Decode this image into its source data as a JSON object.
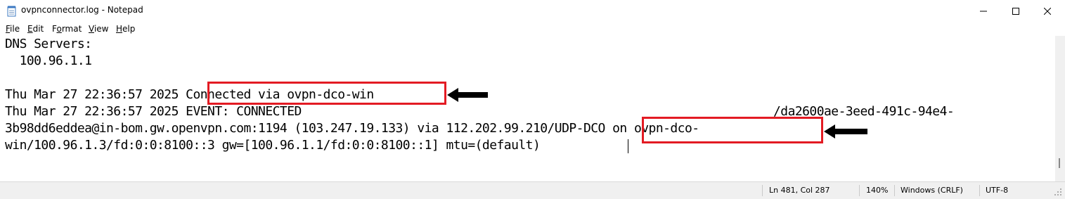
{
  "window": {
    "title": "ovpnconnector.log - Notepad",
    "icon": "notepad-icon"
  },
  "menu": {
    "items": [
      {
        "label_prefix": "",
        "accel": "F",
        "label_rest": "ile"
      },
      {
        "label_prefix": "",
        "accel": "E",
        "label_rest": "dit"
      },
      {
        "label_prefix": "F",
        "accel": "o",
        "label_rest": "rmat"
      },
      {
        "label_prefix": "",
        "accel": "V",
        "label_rest": "iew"
      },
      {
        "label_prefix": "",
        "accel": "H",
        "label_rest": "elp"
      }
    ]
  },
  "editor": {
    "lines": [
      "DNS Servers:",
      "  100.96.1.1",
      "",
      "Thu Mar 27 22:36:57 2025 Connected via ovpn-dco-win",
      "Thu Mar 27 22:36:57 2025 EVENT: CONNECTED ",
      "3b98dd6eddea@in-bom.gw.openvpn.com:1194 (103.247.19.133) via 112.202.99.210/UDP-DCO on ovpn-dco-",
      "win/100.96.1.3/fd:0:0:8100::3 gw=[100.96.1.1/fd:0:0:8100::1] mtu=(default)"
    ],
    "line4_tail": "/da2600ae-3eed-491c-94e4-"
  },
  "status": {
    "position": "Ln 481, Col 287",
    "zoom": "140%",
    "line_ending": "Windows (CRLF)",
    "encoding": "UTF-8"
  },
  "annotations": {
    "highlight_color": "#e31b23",
    "highlight_1_text": "Connected via ovpn-dco-win",
    "highlight_2_text": "UDP-DCO on ovpn-dco-"
  }
}
